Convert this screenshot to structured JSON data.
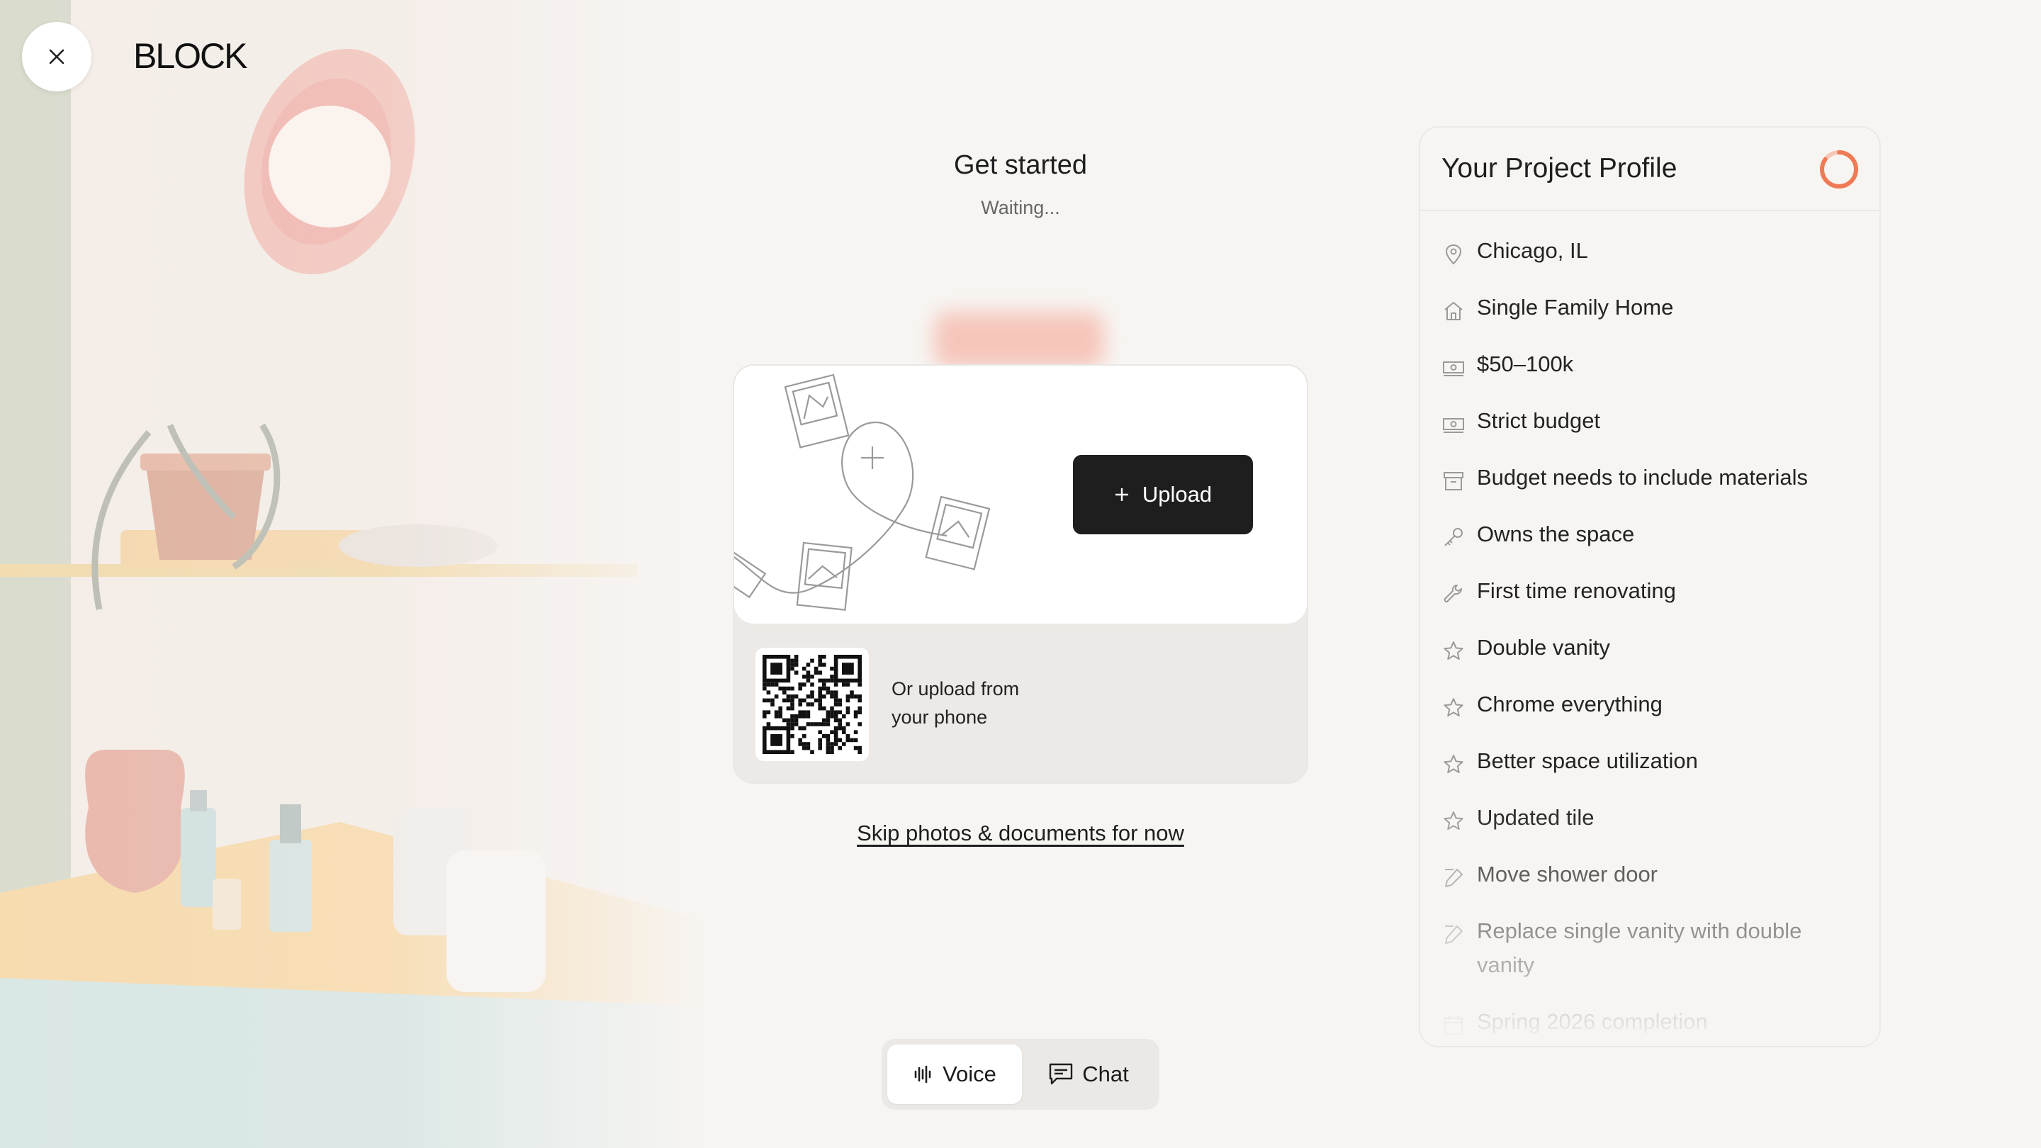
{
  "header": {
    "logo": "BLOCK",
    "close_icon": "close-icon"
  },
  "main": {
    "title": "Get started",
    "status": "Waiting...",
    "upload_label": "Upload",
    "phone_upload_text": "Or upload from your phone",
    "skip_link": "Skip photos & documents for now"
  },
  "mode": {
    "voice_label": "Voice",
    "chat_label": "Chat",
    "selected": "Voice"
  },
  "profile": {
    "title": "Your Project Profile",
    "progress": 0.85,
    "accent": "#f07a55",
    "items": [
      {
        "icon": "location-pin-icon",
        "label": "Chicago, IL"
      },
      {
        "icon": "house-icon",
        "label": "Single Family Home"
      },
      {
        "icon": "money-icon",
        "label": "$50–100k"
      },
      {
        "icon": "money-icon",
        "label": "Strict budget"
      },
      {
        "icon": "archive-box-icon",
        "label": "Budget needs to include materials"
      },
      {
        "icon": "key-icon",
        "label": "Owns the space"
      },
      {
        "icon": "wrench-icon",
        "label": "First time renovating"
      },
      {
        "icon": "star-icon",
        "label": "Double vanity"
      },
      {
        "icon": "star-icon",
        "label": "Chrome everything"
      },
      {
        "icon": "star-icon",
        "label": "Better space utilization"
      },
      {
        "icon": "star-icon",
        "label": "Updated tile"
      },
      {
        "icon": "edit-icon",
        "label": "Move shower door"
      },
      {
        "icon": "edit-icon",
        "label": "Replace single vanity with double vanity"
      },
      {
        "icon": "calendar-icon",
        "label": "Spring 2026 completion"
      }
    ]
  }
}
